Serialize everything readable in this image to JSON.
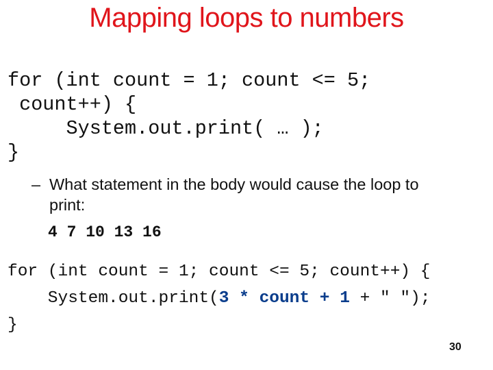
{
  "slide": {
    "title": "Mapping loops to numbers",
    "title_color": "#e0151b",
    "code_template": {
      "lines": [
        "for (int count = 1; count <= 5;",
        " count++) {",
        "     System.out.print( … );",
        "}"
      ]
    },
    "question": {
      "dash": "–",
      "line1": "What statement in the body would cause the loop to",
      "line2": "print:",
      "expected_output": "4 7 10 13 16"
    },
    "solution": {
      "line1": "for (int count = 1; count <= 5; count++) {",
      "line2_prefix": "    System.out.print(",
      "line2_highlight": "3 * count + 1",
      "line2_suffix": " + \" \");",
      "line3": "}",
      "highlight_color": "#0a3d8c"
    },
    "slide_number": "30"
  }
}
